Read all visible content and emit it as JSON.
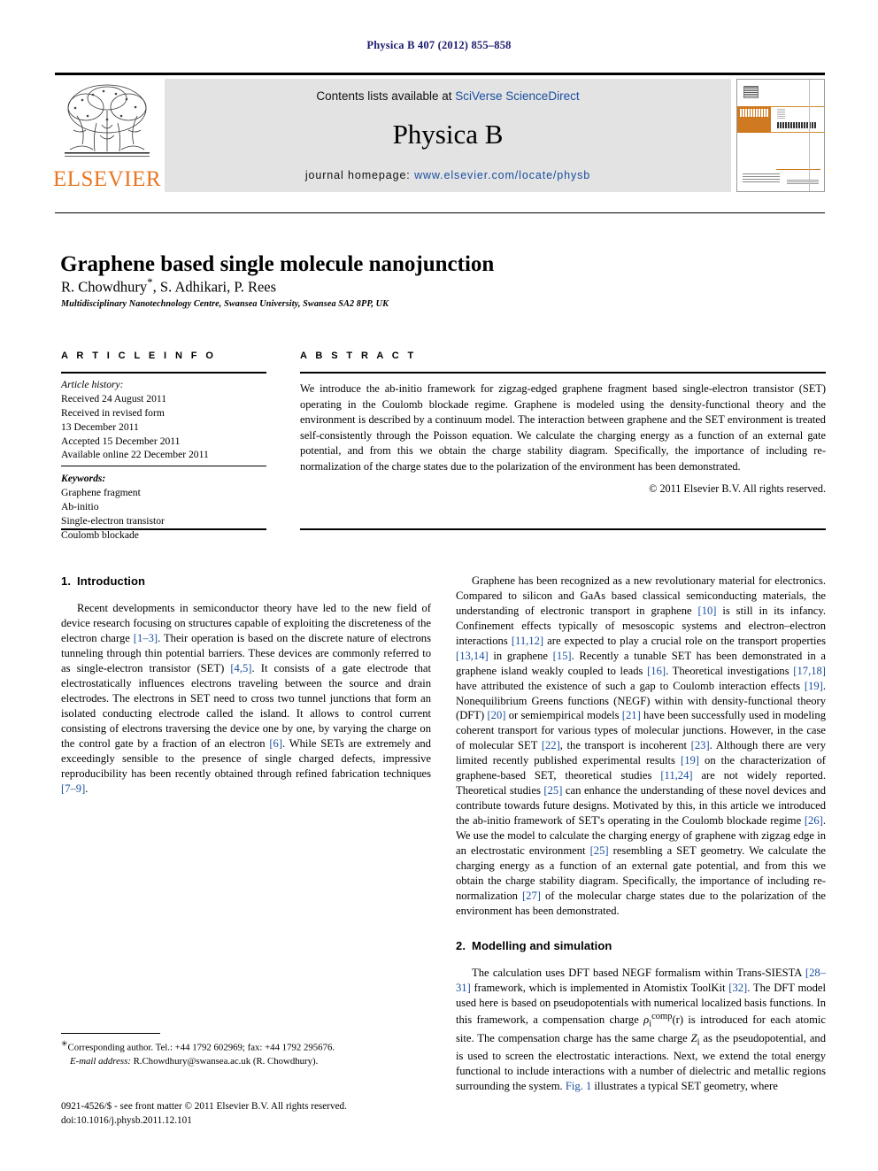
{
  "running_head": "Physica B 407 (2012) 855–858",
  "masthead": {
    "publisher": "ELSEVIER",
    "contents_prefix": "Contents lists available at ",
    "contents_link": "SciVerse ScienceDirect",
    "journal_title": "Physica B",
    "homepage_prefix": "journal homepage: ",
    "homepage_link": "www.elsevier.com/locate/physb",
    "cover_label_physica": "PHYSICA",
    "cover_label_b": "B"
  },
  "article": {
    "title": "Graphene based single molecule nanojunction",
    "authors": "R. Chowdhury",
    "authors_rest": ", S. Adhikari, P. Rees",
    "corresponding_marker": "*",
    "affiliation": "Multidisciplinary Nanotechnology Centre, Swansea University, Swansea SA2 8PP, UK"
  },
  "article_info": {
    "heading": "A R T I C L E   I N F O",
    "history_label": "Article history:",
    "history": [
      "Received 24 August 2011",
      "Received in revised form",
      "13 December 2011",
      "Accepted 15 December 2011",
      "Available online 22 December 2011"
    ],
    "keywords_label": "Keywords:",
    "keywords": [
      "Graphene fragment",
      "Ab-initio",
      "Single-electron transistor",
      "Coulomb blockade"
    ]
  },
  "abstract": {
    "heading": "A B S T R A C T",
    "text": "We introduce the ab-initio framework for zigzag-edged graphene fragment based single-electron transistor (SET) operating in the Coulomb blockade regime. Graphene is modeled using the density-functional theory and the environment is described by a continuum model. The interaction between graphene and the SET environment is treated self-consistently through the Poisson equation. We calculate the charging energy as a function of an external gate potential, and from this we obtain the charge stability diagram. Specifically, the importance of including re-normalization of the charge states due to the polarization of the environment has been demonstrated.",
    "copyright": "© 2011 Elsevier B.V. All rights reserved."
  },
  "sections": {
    "intro": {
      "number": "1.",
      "title": "Introduction",
      "p1_a": "Recent developments in semiconductor theory have led to the new field of device research focusing on structures capable of exploiting the discreteness of the electron charge ",
      "p1_r1": "[1–3]",
      "p1_b": ". Their operation is based on the discrete nature of electrons tunneling through thin potential barriers. These devices are commonly referred to as single-electron transistor (SET) ",
      "p1_r2": "[4,5]",
      "p1_c": ". It consists of a gate electrode that electrostatically influences electrons traveling between the source and drain electrodes. The electrons in SET need to cross two tunnel junctions that form an isolated conducting electrode called the island. It allows to control current consisting of electrons traversing the device one by one, by varying the charge on the control gate by a fraction of an electron ",
      "p1_r3": "[6]",
      "p1_d": ". While SETs are extremely and exceedingly sensible to the presence of single charged defects, impressive reproducibility has been recently obtained through refined fabrication techniques ",
      "p1_r4": "[7–9]",
      "p1_e": ".",
      "p2_a": "Graphene has been recognized as a new revolutionary material for electronics. Compared to silicon and GaAs based classical semiconducting materials, the understanding of electronic transport in graphene ",
      "p2_r1": "[10]",
      "p2_b": " is still in its infancy. Confinement effects typically of mesoscopic systems and electron–electron interactions ",
      "p2_r2": "[11,12]",
      "p2_c": " are expected to play a crucial role on the transport properties ",
      "p2_r3": "[13,14]",
      "p2_d": " in graphene ",
      "p2_r4": "[15]",
      "p2_e": ". Recently a tunable SET has been demonstrated in a graphene island weakly coupled to leads ",
      "p2_r5": "[16]",
      "p2_f": ". Theoretical investigations ",
      "p2_r6": "[17,18]",
      "p2_g": " have attributed the existence of such a gap to Coulomb interaction effects ",
      "p2_r7": "[19]",
      "p2_h": ". Nonequilibrium Greens functions (NEGF) within with density-functional theory (DFT) ",
      "p2_r8": "[20]",
      "p2_i": " or semiempirical models ",
      "p2_r9": "[21]",
      "p2_j": " have been successfully used in modeling coherent transport for various types of molecular junctions. However, in the case of molecular SET ",
      "p2_r10": "[22]",
      "p2_k": ", the transport is incoherent ",
      "p2_r11": "[23]",
      "p2_l": ". Although there are very limited recently published experimental results ",
      "p2_r12": "[19]",
      "p2_m": " on the characterization of graphene-based SET, theoretical studies ",
      "p2_r13": "[11,24]",
      "p2_n": " are not widely reported. Theoretical studies ",
      "p2_r14": "[25]",
      "p2_o": " can enhance the understanding of these novel devices and contribute towards future designs. Motivated by this, in this article we introduced the ab-initio framework of SET's operating in the Coulomb blockade regime ",
      "p2_r15": "[26]",
      "p2_p": ". We use the model to calculate the charging energy of graphene with zigzag edge in an electrostatic environment ",
      "p2_r16": "[25]",
      "p2_q": " resembling a SET geometry. We calculate the charging energy as a function of an external gate potential, and from this we obtain the charge stability diagram. Specifically, the importance of including re-normalization ",
      "p2_r17": "[27]",
      "p2_r": " of the molecular charge states due to the polarization of the environment has been demonstrated."
    },
    "modelling": {
      "number": "2.",
      "title": "Modelling and simulation",
      "p1_a": "The calculation uses DFT based NEGF formalism within Trans-SIESTA ",
      "p1_r1": "[28–31]",
      "p1_b": " framework, which is implemented in Atomistix ToolKit ",
      "p1_r2": "[32]",
      "p1_c": ". The DFT model used here is based on pseudopotentials with numerical localized basis functions. In this framework, a compensation charge ",
      "p1_math_base": "ρ",
      "p1_math_sub": "i",
      "p1_math_sup": "comp",
      "p1_math_arg": "(r)",
      "p1_d": " is introduced for each atomic site. The compensation charge has the same charge ",
      "p1_math2_base": "Z",
      "p1_math2_sub": "i",
      "p1_e": " as the pseudopotential, and is used to screen the electrostatic interactions. Next, we extend the total energy functional to include interactions with a number of dielectric and metallic regions surrounding the system. ",
      "p1_figref": "Fig. 1",
      "p1_f": " illustrates a typical SET geometry, where"
    }
  },
  "footnotes": {
    "corresponding": "Corresponding author. Tel.: +44 1792 602969; fax: +44 1792 295676.",
    "email_label": "E-mail address:",
    "email": "R.Chowdhury@swansea.ac.uk (R. Chowdhury).",
    "issn_line": "0921-4526/$ - see front matter © 2011 Elsevier B.V. All rights reserved.",
    "doi_line": "doi:10.1016/j.physb.2011.12.101"
  },
  "colors": {
    "link": "#1a4fa0",
    "running_head": "#1a1a6e",
    "elsevier_orange": "#e87722",
    "banner_bg": "#e3e3e3"
  }
}
